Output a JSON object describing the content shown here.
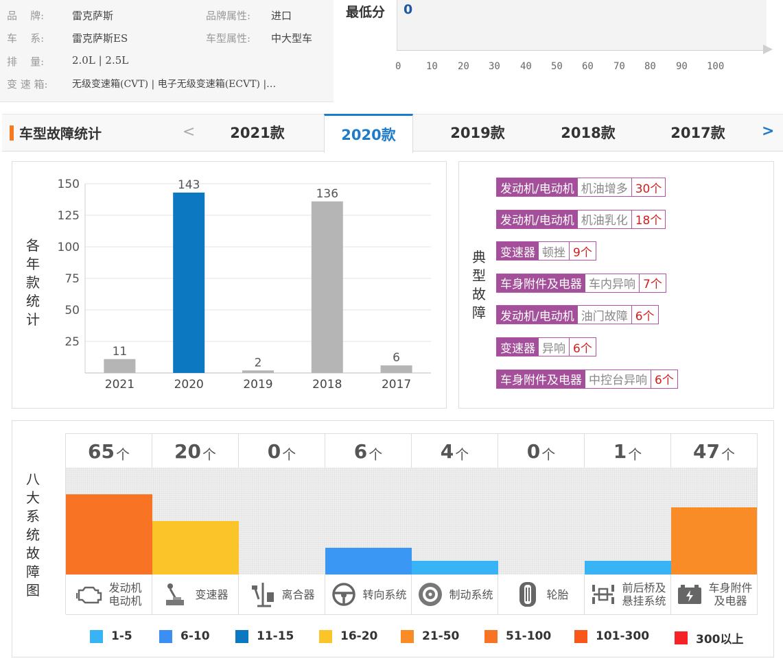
{
  "info": {
    "brand_key": "品    牌:",
    "brand_val": "雷克萨斯",
    "brand_attr_key": "品牌属性:",
    "brand_attr_val": "进口",
    "series_key": "车    系:",
    "series_val": "雷克萨斯ES",
    "model_attr_key": "车型属性:",
    "model_attr_val": "中大型车",
    "displacement_key": "排    量:",
    "displacement_val": "2.0L | 2.5L",
    "gearbox_key": "变 速 箱:",
    "gearbox_val": "无级变速箱(CVT) | 电子无级变速箱(ECVT) |…"
  },
  "score": {
    "label": "最低分",
    "value": "0",
    "ticks": [
      "0",
      "10",
      "20",
      "30",
      "40",
      "50",
      "60",
      "70",
      "80",
      "90",
      "100"
    ]
  },
  "section": {
    "title": "车型故障统计",
    "prev": "<",
    "next": ">",
    "tabs": [
      {
        "label": "2021款",
        "active": false
      },
      {
        "label": "2020款",
        "active": true
      },
      {
        "label": "2019款",
        "active": false
      },
      {
        "label": "2018款",
        "active": false
      },
      {
        "label": "2017款",
        "active": false
      }
    ]
  },
  "yearly": {
    "vertical_label": [
      "各",
      "年",
      "款",
      "统",
      "计"
    ]
  },
  "chart_data": {
    "type": "bar",
    "categories": [
      "2021",
      "2020",
      "2019",
      "2018",
      "2017"
    ],
    "values": [
      11,
      143,
      2,
      136,
      6
    ],
    "highlight_index": 1,
    "colors": {
      "default": "#b5b5b5",
      "highlight": "#0b78c1"
    },
    "yticks": [
      25,
      50,
      75,
      100,
      125,
      150
    ],
    "ylim": [
      0,
      150
    ],
    "grid": true,
    "title": "",
    "xlabel": "",
    "ylabel": "各年款统计"
  },
  "typical_faults": {
    "vertical_label": [
      "典",
      "型",
      "故",
      "障"
    ],
    "items": [
      {
        "category": "发动机/电动机",
        "name": "机油增多",
        "count": "30个"
      },
      {
        "category": "发动机/电动机",
        "name": "机油乳化",
        "count": "18个"
      },
      {
        "category": "变速器",
        "name": "顿挫",
        "count": "9个"
      },
      {
        "category": "车身附件及电器",
        "name": "车内异响",
        "count": "7个"
      },
      {
        "category": "发动机/电动机",
        "name": "油门故障",
        "count": "6个"
      },
      {
        "category": "变速器",
        "name": "异响",
        "count": "6个"
      },
      {
        "category": "车身附件及电器",
        "name": "中控台异响",
        "count": "6个"
      }
    ]
  },
  "systems": {
    "vertical_label": [
      "八",
      "大",
      "系",
      "统",
      "故",
      "障",
      "图"
    ],
    "unit": "个",
    "items": [
      {
        "count": "65",
        "value": 65,
        "lines": [
          "发动机",
          "电动机"
        ],
        "icon": "engine-icon",
        "color": "#f97324",
        "level": 0.75
      },
      {
        "count": "20",
        "value": 20,
        "lines": [
          "变速器"
        ],
        "icon": "gear-shift-icon",
        "color": "#fbc52a",
        "level": 0.5
      },
      {
        "count": "0",
        "value": 0,
        "lines": [
          "离合器"
        ],
        "icon": "clutch-pedal-icon",
        "color": "#cccccc",
        "level": 0
      },
      {
        "count": "6",
        "value": 6,
        "lines": [
          "转向系统"
        ],
        "icon": "steering-wheel-icon",
        "color": "#3b97f4",
        "level": 0.25
      },
      {
        "count": "4",
        "value": 4,
        "lines": [
          "制动系统"
        ],
        "icon": "brake-disc-icon",
        "color": "#38b4f6",
        "level": 0.125
      },
      {
        "count": "0",
        "value": 0,
        "lines": [
          "轮胎"
        ],
        "icon": "tire-icon",
        "color": "#cccccc",
        "level": 0
      },
      {
        "count": "1",
        "value": 1,
        "lines": [
          "前后桥及",
          "悬挂系统"
        ],
        "icon": "axle-suspension-icon",
        "color": "#38b4f6",
        "level": 0.125
      },
      {
        "count": "47",
        "value": 47,
        "lines": [
          "车身附件",
          "及电器"
        ],
        "icon": "battery-electrical-icon",
        "color": "#f98c26",
        "level": 0.625
      }
    ]
  },
  "legend": [
    {
      "label": "1-5",
      "color": "#38b4f6"
    },
    {
      "label": "6-10",
      "color": "#3b8ff2"
    },
    {
      "label": "11-15",
      "color": "#0b78c1"
    },
    {
      "label": "16-20",
      "color": "#fbc52a"
    },
    {
      "label": "21-50",
      "color": "#f98c26"
    },
    {
      "label": "51-100",
      "color": "#f97324"
    },
    {
      "label": "101-300",
      "color": "#f9561c"
    },
    {
      "label": "300以上",
      "color": "#f52325"
    }
  ]
}
